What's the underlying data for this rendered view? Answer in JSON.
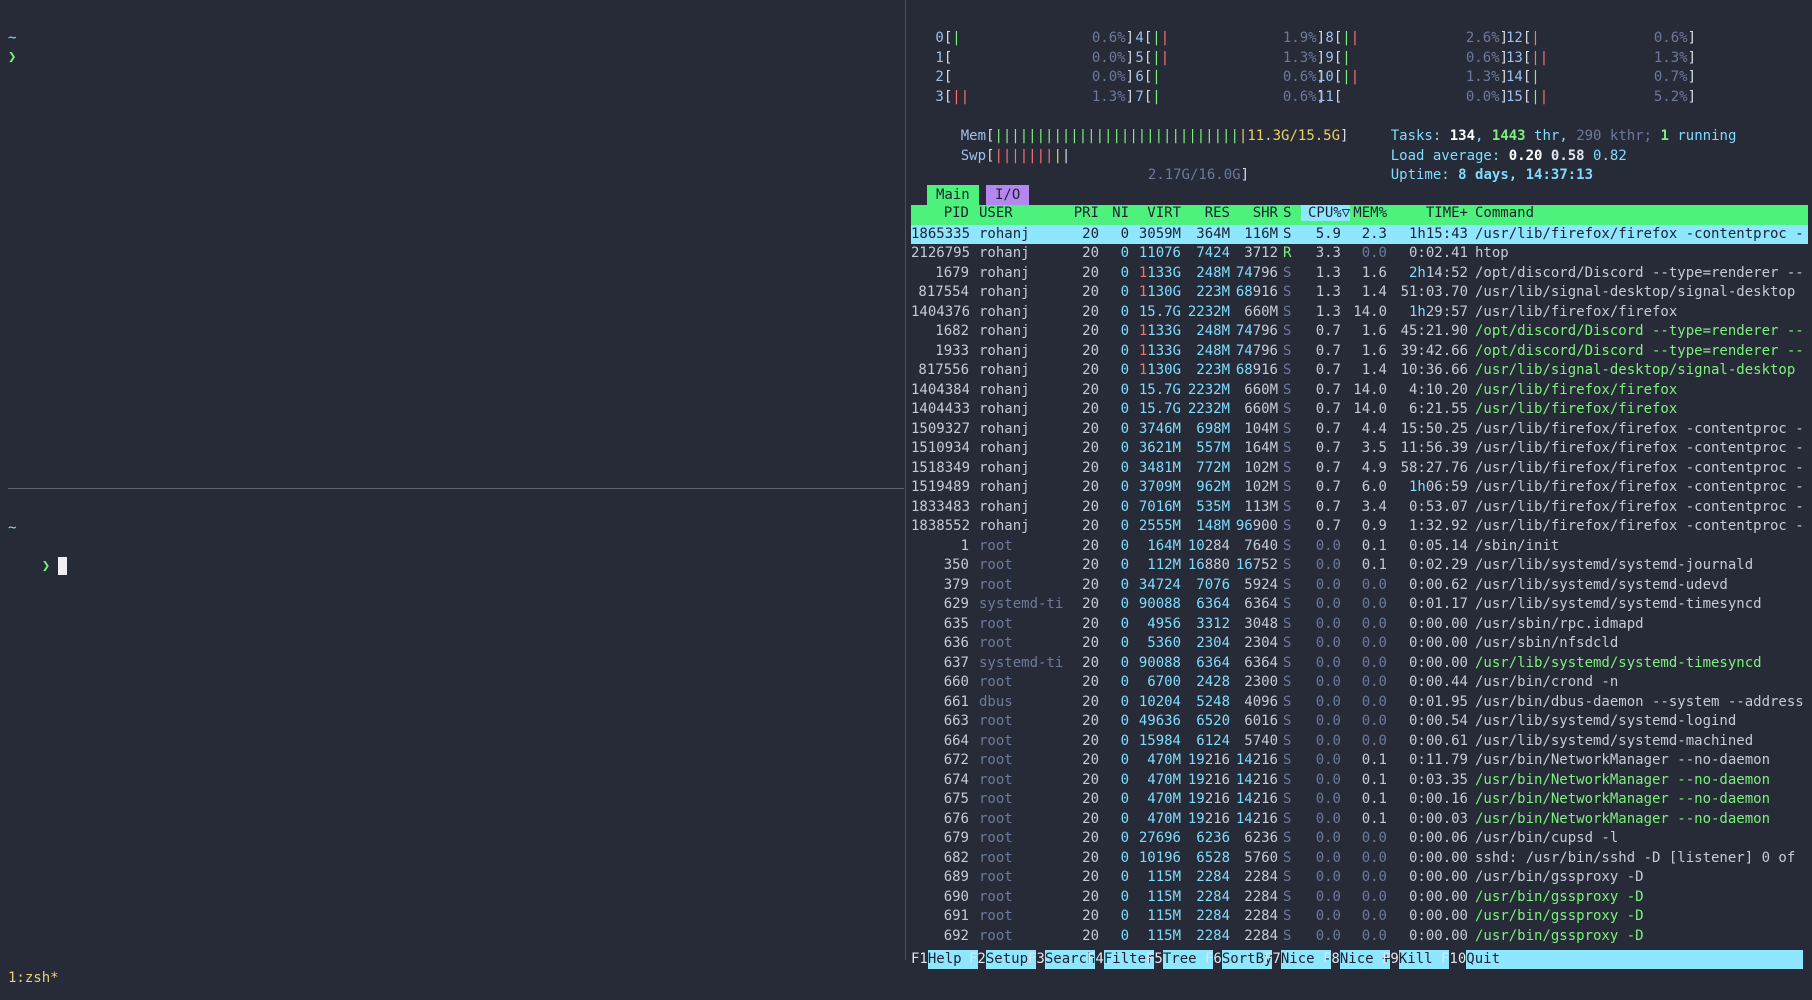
{
  "terminal": {
    "top_pane": {
      "tilde": "~",
      "prompt": "❯"
    },
    "bottom_pane": {
      "tilde": "~",
      "prompt": "❯"
    },
    "status": "1:zsh*"
  },
  "htop": {
    "cpus": [
      {
        "id": "0",
        "bars": [
          [
            "g",
            "|"
          ]
        ],
        "pct": "0.6%"
      },
      {
        "id": "1",
        "bars": [],
        "pct": "0.0%"
      },
      {
        "id": "2",
        "bars": [],
        "pct": "0.0%"
      },
      {
        "id": "3",
        "bars": [
          [
            "r",
            "|"
          ],
          [
            "r",
            "|"
          ]
        ],
        "pct": "1.3%"
      },
      {
        "id": "4",
        "bars": [
          [
            "g",
            "|"
          ],
          [
            "r",
            "|"
          ]
        ],
        "pct": "1.9%"
      },
      {
        "id": "5",
        "bars": [
          [
            "g",
            "|"
          ],
          [
            "r",
            "|"
          ]
        ],
        "pct": "1.3%"
      },
      {
        "id": "6",
        "bars": [
          [
            "g",
            "|"
          ]
        ],
        "pct": "0.6%"
      },
      {
        "id": "7",
        "bars": [
          [
            "g",
            "|"
          ]
        ],
        "pct": "0.6%"
      },
      {
        "id": "8",
        "bars": [
          [
            "g",
            "|"
          ],
          [
            "r",
            "|"
          ]
        ],
        "pct": "2.6%"
      },
      {
        "id": "9",
        "bars": [
          [
            "g",
            "|"
          ]
        ],
        "pct": "0.6%"
      },
      {
        "id": "10",
        "bars": [
          [
            "g",
            "|"
          ],
          [
            "r",
            "|"
          ]
        ],
        "pct": "1.3%"
      },
      {
        "id": "11",
        "bars": [],
        "pct": "0.0%"
      },
      {
        "id": "12",
        "bars": [
          [
            "r",
            "|"
          ]
        ],
        "pct": "0.6%"
      },
      {
        "id": "13",
        "bars": [
          [
            "r",
            "|"
          ],
          [
            "r",
            "|"
          ]
        ],
        "pct": "1.3%"
      },
      {
        "id": "14",
        "bars": [
          [
            "g",
            "|"
          ]
        ],
        "pct": "0.7%"
      },
      {
        "id": "15",
        "bars": [
          [
            "g",
            "|"
          ],
          [
            "r",
            "|"
          ]
        ],
        "pct": "5.2%"
      }
    ],
    "mem": {
      "label": "Mem",
      "value": "11.3G/15.5G"
    },
    "swp": {
      "label": "Swp",
      "value": "2.17G/16.0G"
    },
    "tasks": {
      "label": "Tasks:",
      "tasks": "134",
      "thr": "1443",
      "thr_label": "thr,",
      "kthr": "290 kthr;",
      "running": "1",
      "running_label": "running"
    },
    "load": {
      "label": "Load average:",
      "l1": "0.20",
      "l5": "0.58",
      "l15": "0.82"
    },
    "uptime": {
      "label": "Uptime:",
      "value": "8 days, 14:37:13"
    },
    "tabs": {
      "main": "Main",
      "io": "I/O"
    },
    "columns": {
      "pid": "PID",
      "user": "USER",
      "pri": "PRI",
      "ni": "NI",
      "virt": "VIRT",
      "res": "RES",
      "shr": "SHR",
      "s": "S",
      "cpu": "CPU%▽",
      "mem": "MEM%",
      "time": "TIME+",
      "cmd": "Command"
    },
    "processes": [
      [
        "1865335",
        "rohanj",
        "20",
        "0",
        "3059M",
        "364M",
        "116M",
        "S",
        "5.9",
        "2.3",
        "1h15:43",
        "/usr/lib/firefox/firefox -contentproc -",
        0
      ],
      [
        "2126795",
        "rohanj",
        "20",
        "0",
        "11076",
        "7424",
        "3712",
        "R",
        "3.3",
        "0.0",
        "0:02.41",
        "htop",
        0
      ],
      [
        "1679",
        "rohanj",
        "20",
        "0",
        "1133G",
        "248M",
        "74796",
        "S",
        "1.3",
        "1.6",
        "2h14:52",
        "/opt/discord/Discord --type=renderer --",
        0
      ],
      [
        "817554",
        "rohanj",
        "20",
        "0",
        "1130G",
        "223M",
        "68916",
        "S",
        "1.3",
        "1.4",
        "51:03.70",
        "/usr/lib/signal-desktop/signal-desktop",
        0
      ],
      [
        "1404376",
        "rohanj",
        "20",
        "0",
        "15.7G",
        "2232M",
        "660M",
        "S",
        "1.3",
        "14.0",
        "1h29:57",
        "/usr/lib/firefox/firefox",
        0
      ],
      [
        "1682",
        "rohanj",
        "20",
        "0",
        "1133G",
        "248M",
        "74796",
        "S",
        "0.7",
        "1.6",
        "45:21.90",
        "/opt/discord/Discord --type=renderer --",
        1
      ],
      [
        "1933",
        "rohanj",
        "20",
        "0",
        "1133G",
        "248M",
        "74796",
        "S",
        "0.7",
        "1.6",
        "39:42.66",
        "/opt/discord/Discord --type=renderer --",
        1
      ],
      [
        "817556",
        "rohanj",
        "20",
        "0",
        "1130G",
        "223M",
        "68916",
        "S",
        "0.7",
        "1.4",
        "10:36.66",
        "/usr/lib/signal-desktop/signal-desktop",
        1
      ],
      [
        "1404384",
        "rohanj",
        "20",
        "0",
        "15.7G",
        "2232M",
        "660M",
        "S",
        "0.7",
        "14.0",
        "4:10.20",
        "/usr/lib/firefox/firefox",
        1
      ],
      [
        "1404433",
        "rohanj",
        "20",
        "0",
        "15.7G",
        "2232M",
        "660M",
        "S",
        "0.7",
        "14.0",
        "6:21.55",
        "/usr/lib/firefox/firefox",
        1
      ],
      [
        "1509327",
        "rohanj",
        "20",
        "0",
        "3746M",
        "698M",
        "104M",
        "S",
        "0.7",
        "4.4",
        "15:50.25",
        "/usr/lib/firefox/firefox -contentproc -",
        0
      ],
      [
        "1510934",
        "rohanj",
        "20",
        "0",
        "3621M",
        "557M",
        "164M",
        "S",
        "0.7",
        "3.5",
        "11:56.39",
        "/usr/lib/firefox/firefox -contentproc -",
        0
      ],
      [
        "1518349",
        "rohanj",
        "20",
        "0",
        "3481M",
        "772M",
        "102M",
        "S",
        "0.7",
        "4.9",
        "58:27.76",
        "/usr/lib/firefox/firefox -contentproc -",
        0
      ],
      [
        "1519489",
        "rohanj",
        "20",
        "0",
        "3709M",
        "962M",
        "102M",
        "S",
        "0.7",
        "6.0",
        "1h06:59",
        "/usr/lib/firefox/firefox -contentproc -",
        0
      ],
      [
        "1833483",
        "rohanj",
        "20",
        "0",
        "7016M",
        "535M",
        "113M",
        "S",
        "0.7",
        "3.4",
        "0:53.07",
        "/usr/lib/firefox/firefox -contentproc -",
        0
      ],
      [
        "1838552",
        "rohanj",
        "20",
        "0",
        "2555M",
        "148M",
        "96900",
        "S",
        "0.7",
        "0.9",
        "1:32.92",
        "/usr/lib/firefox/firefox -contentproc -",
        0
      ],
      [
        "1",
        "root",
        "20",
        "0",
        "164M",
        "10284",
        "7640",
        "S",
        "0.0",
        "0.1",
        "0:05.14",
        "/sbin/init",
        0
      ],
      [
        "350",
        "root",
        "20",
        "0",
        "112M",
        "16880",
        "16752",
        "S",
        "0.0",
        "0.1",
        "0:02.29",
        "/usr/lib/systemd/systemd-journald",
        0
      ],
      [
        "379",
        "root",
        "20",
        "0",
        "34724",
        "7076",
        "5924",
        "S",
        "0.0",
        "0.0",
        "0:00.62",
        "/usr/lib/systemd/systemd-udevd",
        0
      ],
      [
        "629",
        "systemd-ti",
        "20",
        "0",
        "90088",
        "6364",
        "6364",
        "S",
        "0.0",
        "0.0",
        "0:01.17",
        "/usr/lib/systemd/systemd-timesyncd",
        0
      ],
      [
        "635",
        "root",
        "20",
        "0",
        "4956",
        "3312",
        "3048",
        "S",
        "0.0",
        "0.0",
        "0:00.00",
        "/usr/sbin/rpc.idmapd",
        0
      ],
      [
        "636",
        "root",
        "20",
        "0",
        "5360",
        "2304",
        "2304",
        "S",
        "0.0",
        "0.0",
        "0:00.00",
        "/usr/sbin/nfsdcld",
        0
      ],
      [
        "637",
        "systemd-ti",
        "20",
        "0",
        "90088",
        "6364",
        "6364",
        "S",
        "0.0",
        "0.0",
        "0:00.00",
        "/usr/lib/systemd/systemd-timesyncd",
        1
      ],
      [
        "660",
        "root",
        "20",
        "0",
        "6700",
        "2428",
        "2300",
        "S",
        "0.0",
        "0.0",
        "0:00.44",
        "/usr/bin/crond -n",
        0
      ],
      [
        "661",
        "dbus",
        "20",
        "0",
        "10204",
        "5248",
        "4096",
        "S",
        "0.0",
        "0.0",
        "0:01.95",
        "/usr/bin/dbus-daemon --system --address",
        0
      ],
      [
        "663",
        "root",
        "20",
        "0",
        "49636",
        "6520",
        "6016",
        "S",
        "0.0",
        "0.0",
        "0:00.54",
        "/usr/lib/systemd/systemd-logind",
        0
      ],
      [
        "664",
        "root",
        "20",
        "0",
        "15984",
        "6124",
        "5740",
        "S",
        "0.0",
        "0.0",
        "0:00.61",
        "/usr/lib/systemd/systemd-machined",
        0
      ],
      [
        "672",
        "root",
        "20",
        "0",
        "470M",
        "19216",
        "14216",
        "S",
        "0.0",
        "0.1",
        "0:11.79",
        "/usr/bin/NetworkManager --no-daemon",
        0
      ],
      [
        "674",
        "root",
        "20",
        "0",
        "470M",
        "19216",
        "14216",
        "S",
        "0.0",
        "0.1",
        "0:03.35",
        "/usr/bin/NetworkManager --no-daemon",
        1
      ],
      [
        "675",
        "root",
        "20",
        "0",
        "470M",
        "19216",
        "14216",
        "S",
        "0.0",
        "0.1",
        "0:00.16",
        "/usr/bin/NetworkManager --no-daemon",
        1
      ],
      [
        "676",
        "root",
        "20",
        "0",
        "470M",
        "19216",
        "14216",
        "S",
        "0.0",
        "0.1",
        "0:00.03",
        "/usr/bin/NetworkManager --no-daemon",
        1
      ],
      [
        "679",
        "root",
        "20",
        "0",
        "27696",
        "6236",
        "6236",
        "S",
        "0.0",
        "0.0",
        "0:00.06",
        "/usr/bin/cupsd -l",
        0
      ],
      [
        "682",
        "root",
        "20",
        "0",
        "10196",
        "6528",
        "5760",
        "S",
        "0.0",
        "0.0",
        "0:00.00",
        "sshd: /usr/bin/sshd -D [listener] 0 of",
        0
      ],
      [
        "689",
        "root",
        "20",
        "0",
        "115M",
        "2284",
        "2284",
        "S",
        "0.0",
        "0.0",
        "0:00.00",
        "/usr/bin/gssproxy -D",
        0
      ],
      [
        "690",
        "root",
        "20",
        "0",
        "115M",
        "2284",
        "2284",
        "S",
        "0.0",
        "0.0",
        "0:00.00",
        "/usr/bin/gssproxy -D",
        1
      ],
      [
        "691",
        "root",
        "20",
        "0",
        "115M",
        "2284",
        "2284",
        "S",
        "0.0",
        "0.0",
        "0:00.00",
        "/usr/bin/gssproxy -D",
        1
      ],
      [
        "692",
        "root",
        "20",
        "0",
        "115M",
        "2284",
        "2284",
        "S",
        "0.0",
        "0.0",
        "0:00.00",
        "/usr/bin/gssproxy -D",
        1
      ]
    ],
    "fkeys": [
      {
        "key": "F1",
        "label": "Help  "
      },
      {
        "key": "F2",
        "label": "Setup "
      },
      {
        "key": "F3",
        "label": "Search"
      },
      {
        "key": "F4",
        "label": "Filter"
      },
      {
        "key": "F5",
        "label": "Tree  "
      },
      {
        "key": "F6",
        "label": "SortBy"
      },
      {
        "key": "F7",
        "label": "Nice -"
      },
      {
        "key": "F8",
        "label": "Nice +"
      },
      {
        "key": "F9",
        "label": "Kill  "
      },
      {
        "key": "F10",
        "label": "Quit"
      }
    ]
  },
  "colors": {
    "bg": "#272b37",
    "green": "#4df27d",
    "cyan": "#8fe6ff",
    "purple": "#b486f0"
  }
}
